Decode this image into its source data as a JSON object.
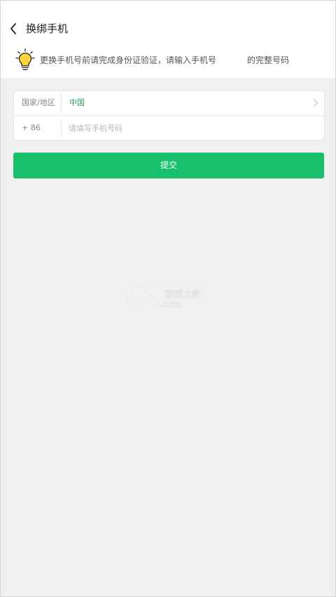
{
  "header": {
    "title": "换绑手机",
    "back_icon": "chevron-left-icon"
  },
  "tip": {
    "icon": "lightbulb-icon",
    "text": "更换手机号前请完成身份证验证，请输入手机号",
    "tail": "的完整号码"
  },
  "form": {
    "country_label": "国家/地区",
    "country_value": "中国",
    "code_label": "+ 86",
    "phone_placeholder": "请填写手机号码",
    "phone_value": ""
  },
  "submit": {
    "label": "提交"
  },
  "watermark": {
    "brand": "K73",
    "sub": "游戏之家",
    "domain": ".com"
  },
  "colors": {
    "accent": "#19c06b",
    "country_text": "#1fa155",
    "background": "#f0f0f0",
    "bulb": "#ffd43b"
  }
}
